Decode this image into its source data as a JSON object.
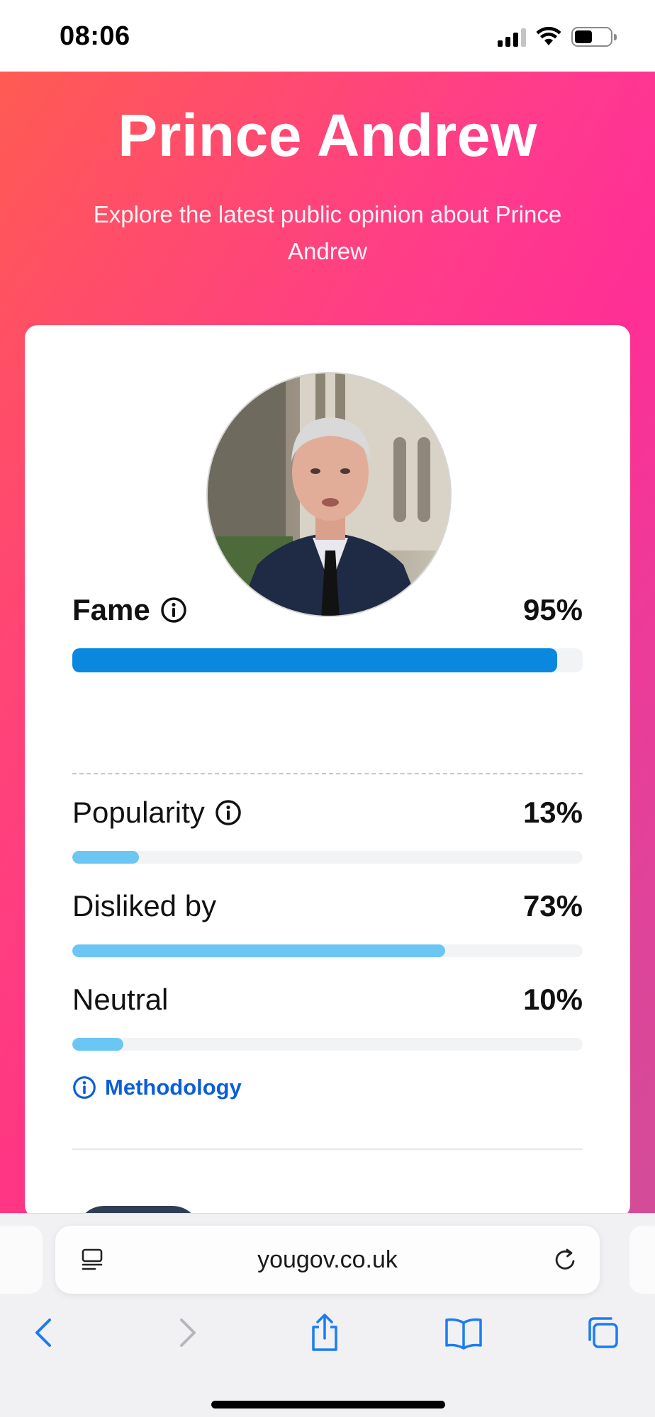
{
  "status_bar": {
    "time": "08:06",
    "icons": [
      "cellular-signal-icon",
      "wifi-icon",
      "battery-icon"
    ],
    "battery_level": 0.5
  },
  "hero": {
    "title": "Prince Andrew",
    "subtitle": "Explore the latest public opinion about Prince Andrew"
  },
  "profile": {
    "image_alt": "Prince Andrew"
  },
  "metrics": [
    {
      "label": "Fame",
      "value_text": "95%",
      "value": 95,
      "has_info": true,
      "color": "#0A88E0"
    },
    {
      "label": "Popularity",
      "value_text": "13%",
      "value": 13,
      "has_info": true,
      "color": "#6CC6F4"
    },
    {
      "label": "Disliked by",
      "value_text": "73%",
      "value": 73,
      "has_info": false,
      "color": "#6CC6F4"
    },
    {
      "label": "Neutral",
      "value_text": "10%",
      "value": 10,
      "has_info": false,
      "color": "#6CC6F4"
    }
  ],
  "methodology": {
    "label": "Methodology",
    "icon": "info-icon",
    "color": "#0B5ED7"
  },
  "browser": {
    "url": "yougov.co.uk",
    "toolbar_icons": [
      "back-icon",
      "forward-icon",
      "share-icon",
      "bookmarks-icon",
      "tabs-icon"
    ],
    "accent": "#1A7CF5"
  }
}
